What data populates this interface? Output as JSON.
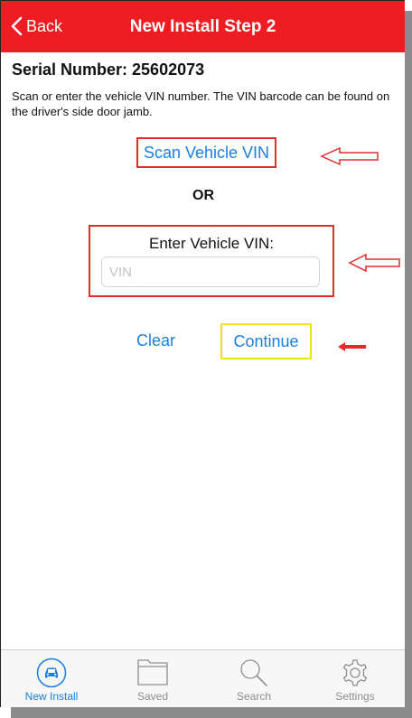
{
  "navbar": {
    "back_label": "Back",
    "title": "New Install Step 2"
  },
  "serial": {
    "text": "Serial Number: 25602073"
  },
  "instructions": "Scan or enter the vehicle VIN number. The VIN barcode can be found on the driver's side door jamb.",
  "scan_button": "Scan Vehicle VIN",
  "or_label": "OR",
  "enter_section": {
    "label": "Enter Vehicle VIN:",
    "vin_placeholder": "VIN",
    "vin_value": ""
  },
  "actions": {
    "clear_label": "Clear",
    "continue_label": "Continue"
  },
  "annotations": {
    "highlight_red": "#e22b2b",
    "highlight_yellow": "#f3e21a"
  },
  "tabbar": {
    "active_color": "#1a7fe0",
    "tabs": [
      {
        "label": "New Install",
        "icon": "car-icon",
        "active": true
      },
      {
        "label": "Saved",
        "icon": "folder-icon",
        "active": false
      },
      {
        "label": "Search",
        "icon": "search-icon",
        "active": false
      },
      {
        "label": "Settings",
        "icon": "gear-icon",
        "active": false
      }
    ]
  },
  "theme": {
    "navbar_color": "#ee1d23",
    "link_color": "#1a7fe0"
  }
}
